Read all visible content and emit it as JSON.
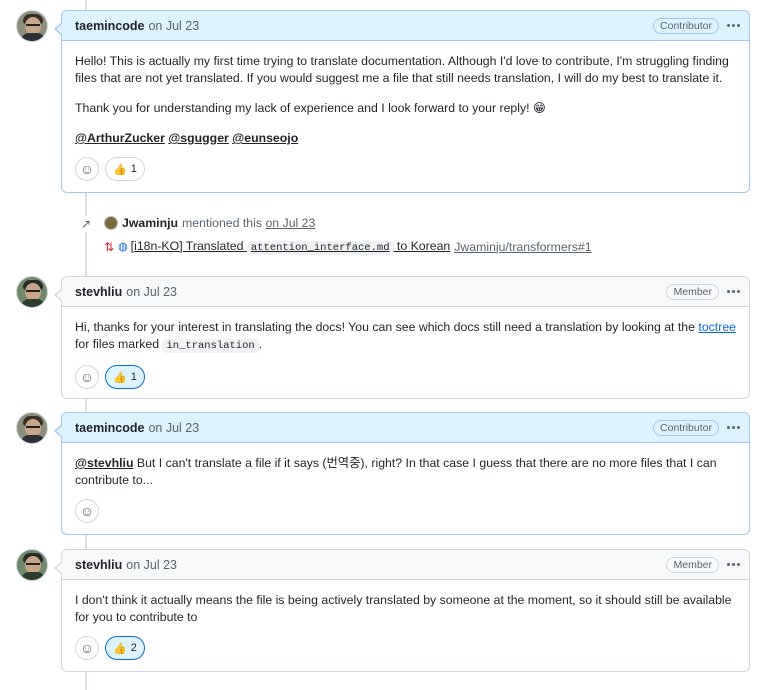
{
  "comments": [
    {
      "author": "taemincode",
      "time": "on Jul 23",
      "role": "Contributor",
      "paragraph1": "Hello! This is actually my first time trying to translate documentation. Although I'd love to contribute, I'm struggling finding files that are not yet translated. If you would suggest me a file that still needs translation, I will do my best to translate it.",
      "paragraph2": "Thank you for understanding my lack of experience and I look forward to your reply! 😁",
      "mentions": [
        "@ArthurZucker",
        "@sgugger",
        "@eunseojo"
      ],
      "reaction_count": "1"
    },
    {
      "author": "stevhliu",
      "time": "on Jul 23",
      "role": "Member",
      "text_before": "Hi, thanks for your interest in translating the docs! You can see which docs still need a translation by looking at the ",
      "link": "toctree",
      "text_middle": " for files marked ",
      "code": "in_translation",
      "text_after": ".",
      "reaction_count": "1"
    },
    {
      "author": "taemincode",
      "time": "on Jul 23",
      "role": "Contributor",
      "mention": "@stevhliu",
      "text": " But I can't translate a file if it says (번역중), right? In that case I guess that there are no more files that I can contribute to..."
    },
    {
      "author": "stevhliu",
      "time": "on Jul 23",
      "role": "Member",
      "text": "I don't think it actually means the file is being actively translated by someone at the moment, so it should still be available for you to contribute to",
      "reaction_count": "2"
    }
  ],
  "event": {
    "author": "Jwaminju",
    "action": "mentioned this",
    "time": "on Jul 23",
    "pr_title_prefix": "[i18n-KO] Translated ",
    "pr_title_code": "attention_interface.md",
    "pr_title_suffix": " to Korean",
    "pr_ref": "Jwaminju/transformers#1"
  },
  "icons": {
    "kebab": "kebab-horizontal-icon",
    "smiley": "smiley-icon",
    "thumbsup": "thumbsup-icon",
    "cross_ref": "cross-reference-icon",
    "pr": "git-pull-request-icon",
    "globe": "globe-icon"
  },
  "colors": {
    "owner_header_bg": "#ddf4ff",
    "owner_border": "#a5c7f0",
    "link": "#0969da",
    "pr_icon": "#cf222e"
  }
}
